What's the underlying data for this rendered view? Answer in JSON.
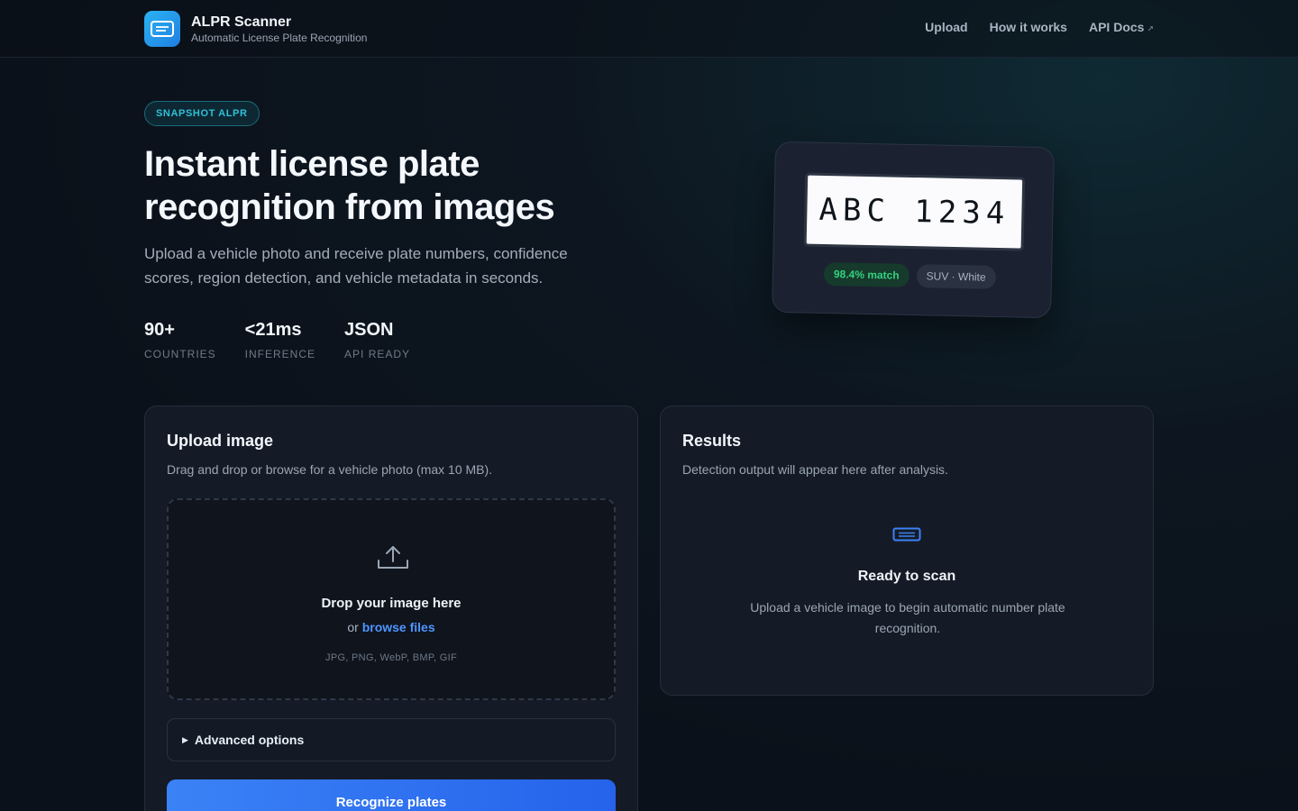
{
  "header": {
    "brand_name": "ALPR Scanner",
    "brand_tagline": "Automatic License Plate Recognition",
    "nav": [
      {
        "label": "Upload"
      },
      {
        "label": "How it works"
      },
      {
        "label": "API Docs",
        "external_marker": "↗"
      }
    ]
  },
  "hero": {
    "badge": "SNAPSHOT ALPR",
    "title": "Instant license plate recognition from images",
    "subtitle": "Upload a vehicle photo and receive plate numbers, confidence scores, region detection, and vehicle metadata in seconds.",
    "stats": [
      {
        "value": "90+",
        "label": "COUNTRIES"
      },
      {
        "value": "<21ms",
        "label": "INFERENCE"
      },
      {
        "value": "JSON",
        "label": "API READY"
      }
    ]
  },
  "plate_preview": {
    "plate_text": "ABC 1234",
    "match_chip": "98.4% match",
    "vehicle_chip": "SUV · White"
  },
  "upload": {
    "title": "Upload image",
    "subtitle": "Drag and drop or browse for a vehicle photo (max 10 MB).",
    "drop_title": "Drop your image here",
    "or_text": "or",
    "browse_link": "browse files",
    "formats": "JPG, PNG, WebP, BMP, GIF",
    "advanced_label": "Advanced options",
    "submit_label": "Recognize plates"
  },
  "results": {
    "title": "Results",
    "subtitle": "Detection output will appear here after analysis.",
    "empty_title": "Ready to scan",
    "empty_subtitle": "Upload a vehicle image to begin automatic number plate recognition."
  },
  "colors": {
    "accent": "#3b82f6",
    "badge": "#2fc0d8",
    "match_green": "#35d07f",
    "background": "#0c1219"
  }
}
